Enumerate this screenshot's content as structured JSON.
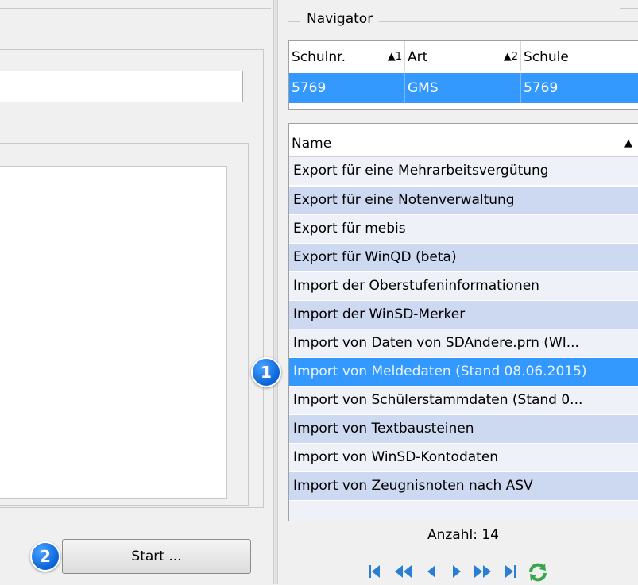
{
  "left": {
    "start_button": "Start ...",
    "badge_2": "2"
  },
  "navigator": {
    "title": "Navigator",
    "columns": [
      {
        "label": "Schulnr.",
        "sort": "▲1"
      },
      {
        "label": "Art",
        "sort": "▲2"
      },
      {
        "label": "Schule",
        "sort": ""
      }
    ],
    "selected_row": [
      "5769",
      "GMS",
      "5769"
    ],
    "name_header": "Name",
    "name_sort": "▲",
    "badge_1": "1",
    "items": [
      "Export für eine Mehrarbeitsvergütung",
      "Export für eine Notenverwaltung",
      "Export für mebis",
      "Export für WinQD (beta)",
      "Import der Oberstufeninformationen",
      "Import der WinSD-Merker",
      "Import von Daten von SDAndere.prn (WI...",
      "Import von Meldedaten (Stand 08.06.2015)",
      "Import von Schülerstammdaten (Stand 0...",
      "Import von Textbausteinen",
      "Import von WinSD-Kontodaten",
      "Import von Zeugnisnoten nach ASV"
    ],
    "selected_index": 7,
    "count": "Anzahl: 14"
  },
  "colors": {
    "selection": "#3399ff",
    "badge": "#0a63d6",
    "pager": "#2a7fd4",
    "refresh": "#3aa64a"
  },
  "pager_icons": [
    "first-icon",
    "prev-page-icon",
    "prev-icon",
    "next-icon",
    "next-page-icon",
    "last-icon",
    "refresh-icon"
  ]
}
